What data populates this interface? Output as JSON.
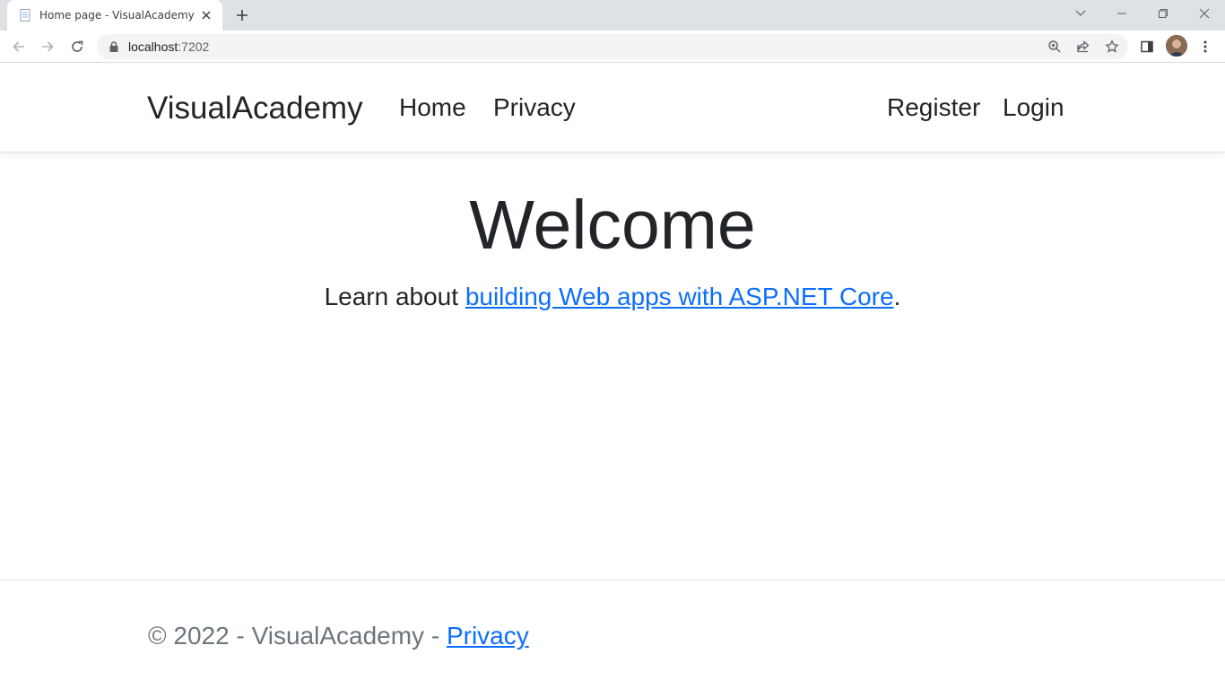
{
  "browser": {
    "tab_title": "Home page - VisualAcademy",
    "url_host": "localhost",
    "url_port": ":7202"
  },
  "site": {
    "brand": "VisualAcademy",
    "nav_left": [
      "Home",
      "Privacy"
    ],
    "nav_right": [
      "Register",
      "Login"
    ]
  },
  "main": {
    "heading": "Welcome",
    "lead_prefix": "Learn about ",
    "lead_link": "building Web apps with ASP.NET Core",
    "lead_suffix": "."
  },
  "footer": {
    "text": "© 2022 - VisualAcademy - ",
    "link": "Privacy"
  },
  "colors": {
    "link": "#0d6efd",
    "text": "#212529",
    "muted": "#6c757d",
    "tabbar": "#dee1e6"
  }
}
